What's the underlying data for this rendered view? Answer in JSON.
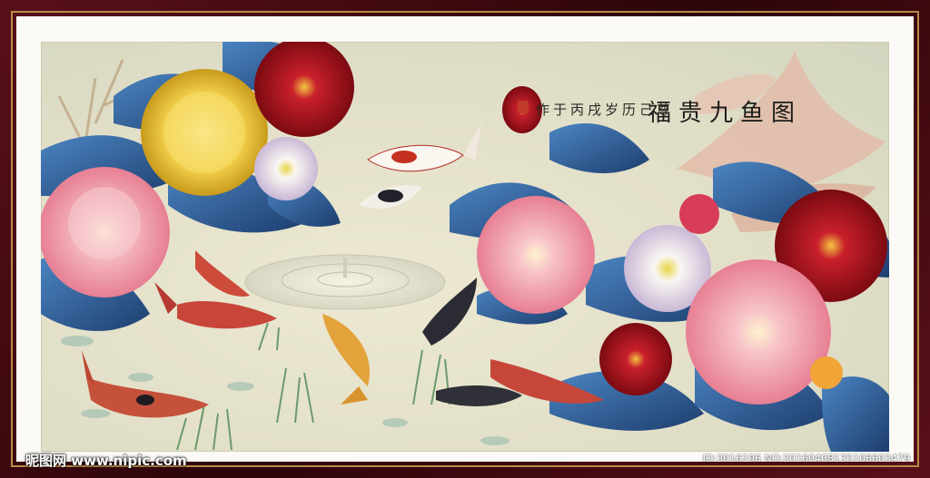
{
  "painting": {
    "title": "福贵九鱼图",
    "inscription": "作于丙戌岁历己尊",
    "colors": {
      "frame": "#4a0c14",
      "mat": "#fbfaf7",
      "background": "#e6e3cc",
      "leaf": "#2f5f95",
      "peony_pink": "#f1a9b3",
      "peony_red": "#b3121d",
      "peony_yellow": "#f1d34a"
    },
    "koi_count": 9
  },
  "watermark": {
    "brand": "昵图网 www.nipic.com",
    "id_text": "ID:3016196 NO:20160408135106603479"
  }
}
